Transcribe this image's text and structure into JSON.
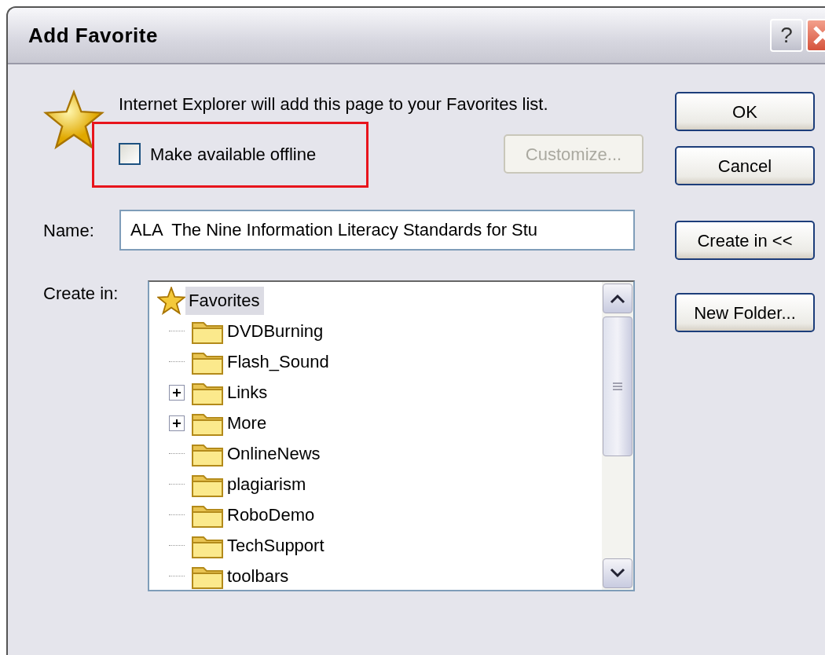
{
  "window": {
    "title": "Add Favorite",
    "title_buttons": [
      "?"
    ]
  },
  "message": "Internet Explorer will add this page to your Favorites list.",
  "offline_option": {
    "label": "Make available offline",
    "checked": false,
    "highlighted": true
  },
  "customize_button": {
    "label": "Customize...",
    "disabled": true
  },
  "name_field": {
    "label": "Name:",
    "value": "ALA  The Nine Information Literacy Standards for Stu"
  },
  "create_in": {
    "label": "Create in:",
    "tree": [
      {
        "label": "Favorites",
        "selected": true,
        "children": [
          {
            "label": "DVDBurning",
            "selected": false,
            "collapsed": false
          },
          {
            "label": "Flash_Sound",
            "selected": false,
            "collapsed": false
          },
          {
            "label": "Links",
            "selected": false,
            "collapsed": true
          },
          {
            "label": "More",
            "selected": false,
            "collapsed": true
          },
          {
            "label": "OnlineNews",
            "selected": false,
            "collapsed": false
          },
          {
            "label": "plagiarism",
            "selected": false,
            "collapsed": false
          },
          {
            "label": "RoboDemo",
            "selected": false,
            "collapsed": false
          },
          {
            "label": "TechSupport",
            "selected": false,
            "collapsed": false
          },
          {
            "label": "toolbars",
            "selected": false,
            "collapsed": false
          }
        ]
      }
    ]
  },
  "buttons": [
    {
      "label": "OK",
      "kind": "ok"
    },
    {
      "label": "Cancel",
      "kind": "cancel"
    },
    {
      "label": "Create in <<",
      "kind": "create"
    },
    {
      "label": "New Folder...",
      "kind": "folder"
    }
  ]
}
